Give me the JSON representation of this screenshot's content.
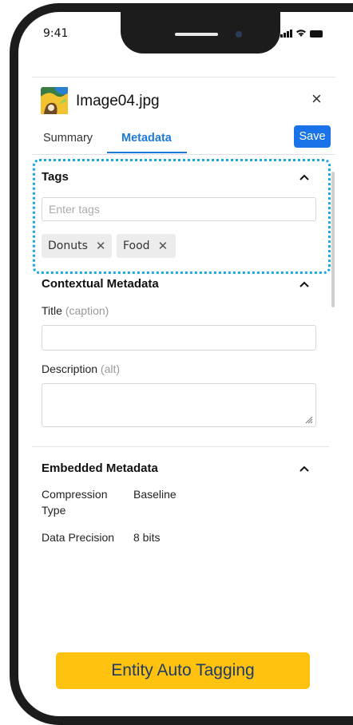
{
  "status_bar": {
    "time": "9:41"
  },
  "panel": {
    "file_name": "Image04.jpg",
    "close_label": "×",
    "tabs": [
      {
        "label": "Summary"
      },
      {
        "label": "Metadata"
      }
    ],
    "save_label": "Save"
  },
  "tags": {
    "heading": "Tags",
    "input_placeholder": "Enter tags",
    "chips": [
      {
        "label": "Donuts"
      },
      {
        "label": "Food"
      }
    ],
    "chip_remove": "✕"
  },
  "contextual": {
    "heading": "Contextual Metadata",
    "title_label": "Title",
    "title_hint": "(caption)",
    "description_label": "Description",
    "description_hint": "(alt)"
  },
  "embedded": {
    "heading": "Embedded Metadata",
    "rows": [
      {
        "key": "Compression Type",
        "value": "Baseline"
      },
      {
        "key": "Data Precision",
        "value": "8 bits"
      }
    ]
  },
  "chevron_up": "⌃",
  "cta_label": "Entity Auto Tagging",
  "colors": {
    "accent": "#1a73e8",
    "cta": "#ffc20e",
    "highlight": "#1aa7e0"
  }
}
